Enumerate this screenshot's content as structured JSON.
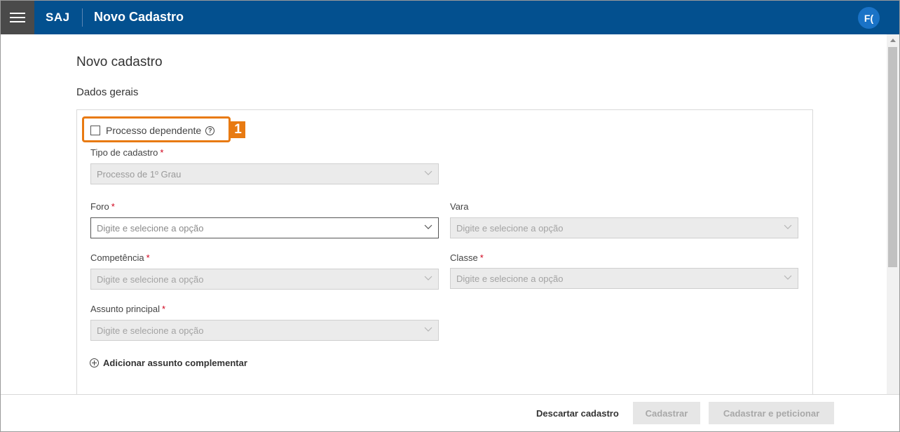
{
  "header": {
    "brand": "SAJ",
    "title": "Novo Cadastro",
    "avatar_initials": "F(",
    "color": "#03508f"
  },
  "page": {
    "title": "Novo cadastro",
    "section": "Dados gerais"
  },
  "form": {
    "dependent_process_label": "Processo dependente",
    "annotation_number": "1",
    "required_mark": "*",
    "tipo_cadastro": {
      "label": "Tipo de cadastro",
      "value": "Processo de 1º Grau"
    },
    "foro": {
      "label": "Foro",
      "placeholder": "Digite e selecione a opção"
    },
    "vara": {
      "label": "Vara",
      "placeholder": "Digite e selecione a opção"
    },
    "competencia": {
      "label": "Competência",
      "placeholder": "Digite e selecione a opção"
    },
    "classe": {
      "label": "Classe",
      "placeholder": "Digite e selecione a opção"
    },
    "assunto_principal": {
      "label": "Assunto principal",
      "placeholder": "Digite e selecione a opção"
    },
    "add_assunto_label": "Adicionar assunto complementar"
  },
  "footer": {
    "discard_label": "Descartar cadastro",
    "submit_label": "Cadastrar",
    "submit_petition_label": "Cadastrar e peticionar"
  },
  "colors": {
    "accent": "#e87a11",
    "required": "#d0021b"
  }
}
